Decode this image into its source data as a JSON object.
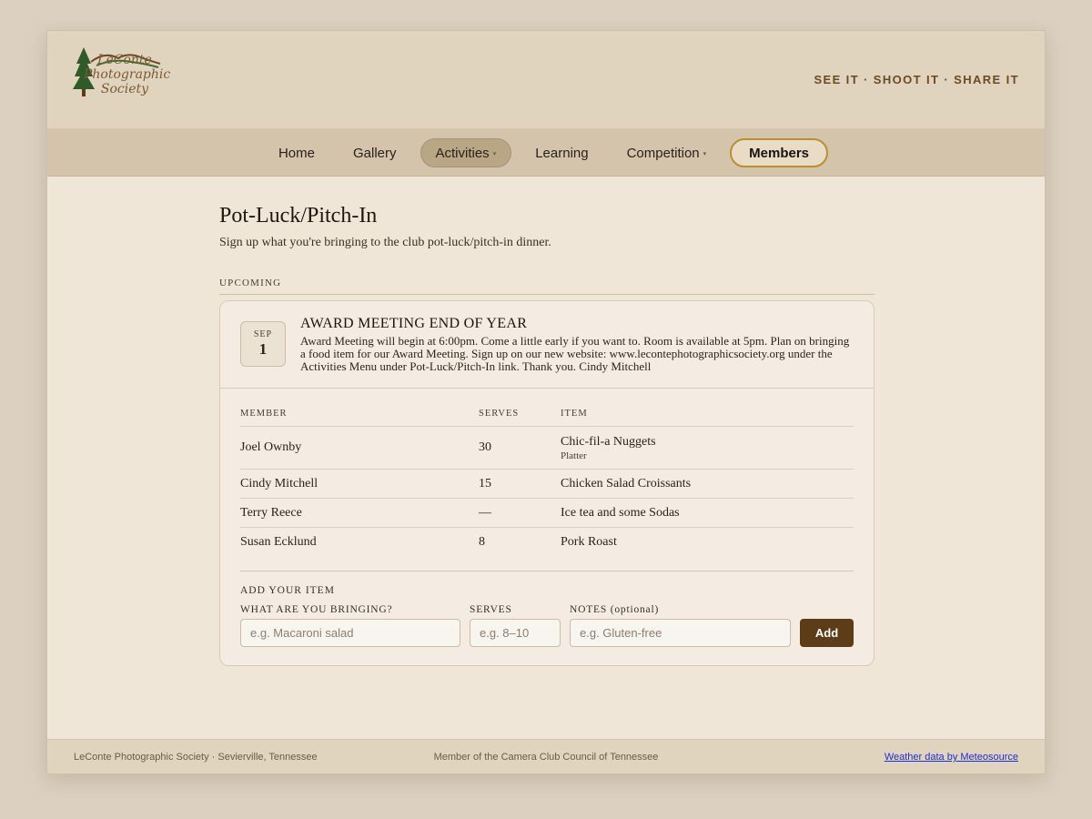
{
  "header": {
    "logo_text": [
      "LeConte",
      "Photographic",
      "Society"
    ],
    "tagline": "SEE IT · SHOOT IT · SHARE IT"
  },
  "nav": {
    "items": [
      {
        "label": "Home"
      },
      {
        "label": "Gallery"
      },
      {
        "label": "Activities"
      },
      {
        "label": "Learning"
      },
      {
        "label": "Competition"
      },
      {
        "label": "Members"
      }
    ],
    "dropdown_caret": "▾"
  },
  "page": {
    "title": "Pot-Luck/Pitch-In",
    "subtitle": "Sign up what you're bringing to the club pot-luck/pitch-in dinner.",
    "section_label": "UPCOMING"
  },
  "event": {
    "month": "SEP",
    "day": "1",
    "title": "AWARD MEETING END OF YEAR",
    "description": "Award Meeting will begin at 6:00pm. Come a little early if you want to. Room is available at 5pm. Plan on bringing a food item for our Award Meeting. Sign up on our new website: www.lecontephotographicsociety.org under the Activities Menu under Pot-Luck/Pitch-In link. Thank you. Cindy Mitchell"
  },
  "table": {
    "headers": [
      "MEMBER",
      "SERVES",
      "ITEM"
    ],
    "rows": [
      {
        "member": "Joel Ownby",
        "serves": "30",
        "item": "Chic-fil-a Nuggets",
        "note": "Platter"
      },
      {
        "member": "Cindy Mitchell",
        "serves": "15",
        "item": "Chicken Salad Croissants",
        "note": ""
      },
      {
        "member": "Terry Reece",
        "serves": "—",
        "item": "Ice tea and some Sodas",
        "note": ""
      },
      {
        "member": "Susan Ecklund",
        "serves": "8",
        "item": "Pork Roast",
        "note": ""
      }
    ]
  },
  "form": {
    "label": "ADD YOUR ITEM",
    "item_label": "WHAT ARE YOU BRINGING?",
    "item_placeholder": "e.g. Macaroni salad",
    "serves_label": "SERVES",
    "serves_placeholder": "e.g. 8–10",
    "notes_label": "NOTES (optional)",
    "notes_placeholder": "e.g. Gluten-free",
    "submit_label": "Add"
  },
  "footer": {
    "left": "LeConte Photographic Society · Sevierville, Tennessee",
    "center": "Member of the Camera Club Council of Tennessee",
    "right": "Weather data by Meteosource"
  },
  "colors": {
    "accent": "#5c3d17",
    "members_outline": "#b8912e",
    "link": "#1a2fd6"
  }
}
